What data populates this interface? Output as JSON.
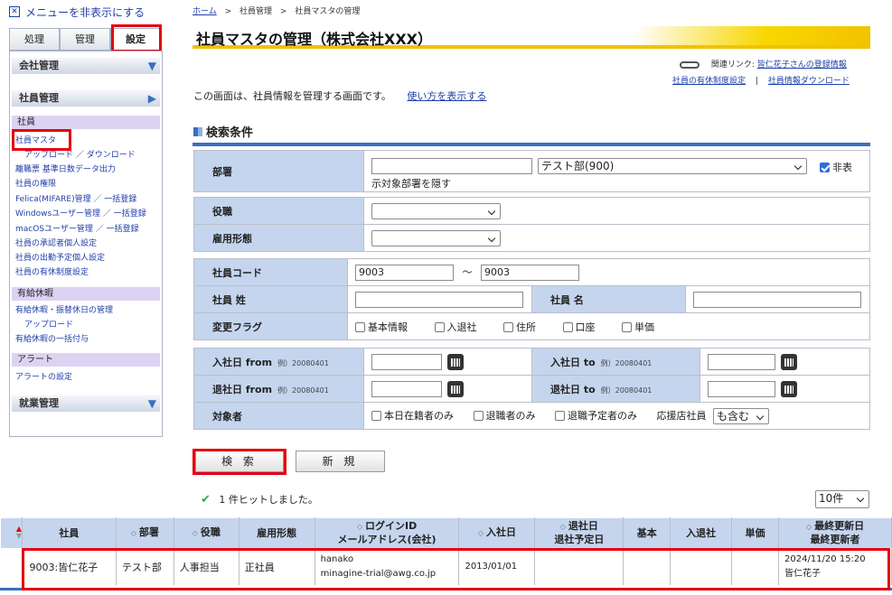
{
  "sidebar": {
    "toggle_label": "メニューを非表示にする",
    "tabs": [
      "処理",
      "管理",
      "設定"
    ],
    "sections": {
      "company": "会社管理",
      "employee": "社員管理",
      "work": "就業管理"
    },
    "groups": {
      "employee": "社員",
      "paid_leave": "有給休暇",
      "alert": "アラート"
    },
    "links": {
      "employee_master": "社員マスタ",
      "upload_download": "アップロード ／ ダウンロード",
      "resignation": "離職票 基準日数データ出力",
      "permissions": "社員の権限",
      "felica": "Felica(MIFARE)管理 ／ 一括登録",
      "windows_user": "Windowsユーザー管理 ／ 一括登録",
      "macos_user": "macOSユーザー管理 ／ 一括登録",
      "approver": "社員の承認者個人設定",
      "attendance_plan": "社員の出勤予定個人設定",
      "paid_leave_system": "社員の有休制度設定",
      "leave_mgmt": "有給休暇・振替休日の管理",
      "upload": "アップロード",
      "bulk_grant": "有給休暇の一括付与",
      "alert_setting": "アラートの設定"
    }
  },
  "breadcrumb": {
    "home": "ホーム",
    "sep": ">",
    "mid": "社員管理",
    "current": "社員マスタの管理"
  },
  "page_title": "社員マスタの管理（株式会社XXX）",
  "related": {
    "label": "関連リンク:",
    "registration": "皆仁花子さんの登録情報",
    "paid_leave": "社員の有休制度設定",
    "sep": "|",
    "download": "社員情報ダウンロード"
  },
  "intro": {
    "text": "この画面は、社員情報を管理する画面です。",
    "link": "使い方を表示する"
  },
  "search": {
    "title": "検索条件",
    "dept_label": "部署",
    "dept_text": "",
    "dept_select": "テスト部(900)",
    "dept_hide_label_1": "非表",
    "dept_hide_label_2": "示対象部署を隠す",
    "position_label": "役職",
    "employment_label": "雇用形態",
    "code_label": "社員コード",
    "code_from": "9003",
    "code_tilde": "～",
    "code_to": "9003",
    "last_name_label": "社員 姓",
    "first_name_label": "社員 名",
    "change_flag_label": "変更フラグ",
    "flags": [
      "基本情報",
      "入退社",
      "住所",
      "口座",
      "単価"
    ],
    "join_from_label": "入社日 from",
    "join_to_label": "入社日 to",
    "leave_from_label": "退社日 from",
    "leave_to_label": "退社日 to",
    "example": "例）20080401",
    "target_label": "対象者",
    "targets": [
      "本日在籍者のみ",
      "退職者のみ",
      "退職予定者のみ"
    ],
    "support_label": "応援店社員",
    "support_value": "も含む"
  },
  "buttons": {
    "search": "検 索",
    "new": "新 規"
  },
  "result": {
    "check": "✔",
    "message": "1 件ヒットしました。",
    "per_page": "10件"
  },
  "table": {
    "headers": [
      "社員",
      "部署",
      "役職",
      "雇用形態",
      "ログインID",
      "メールアドレス(会社)",
      "入社日",
      "退社日",
      "退社予定日",
      "基本",
      "入退社",
      "単価",
      "最終更新日",
      "最終更新者"
    ],
    "row": {
      "employee": "9003:皆仁花子",
      "dept": "テスト部",
      "position": "人事担当",
      "employment": "正社員",
      "login": "hanako",
      "email": "minagine-trial@awg.co.jp",
      "join": "2013/01/01",
      "updated": "2024/11/20 15:20",
      "updater": "皆仁花子"
    }
  },
  "colors": {
    "accent_red": "#e3000f",
    "label_bg": "#c5d5ee",
    "title_bar": "#f2c200",
    "link": "#1f3fa8"
  }
}
